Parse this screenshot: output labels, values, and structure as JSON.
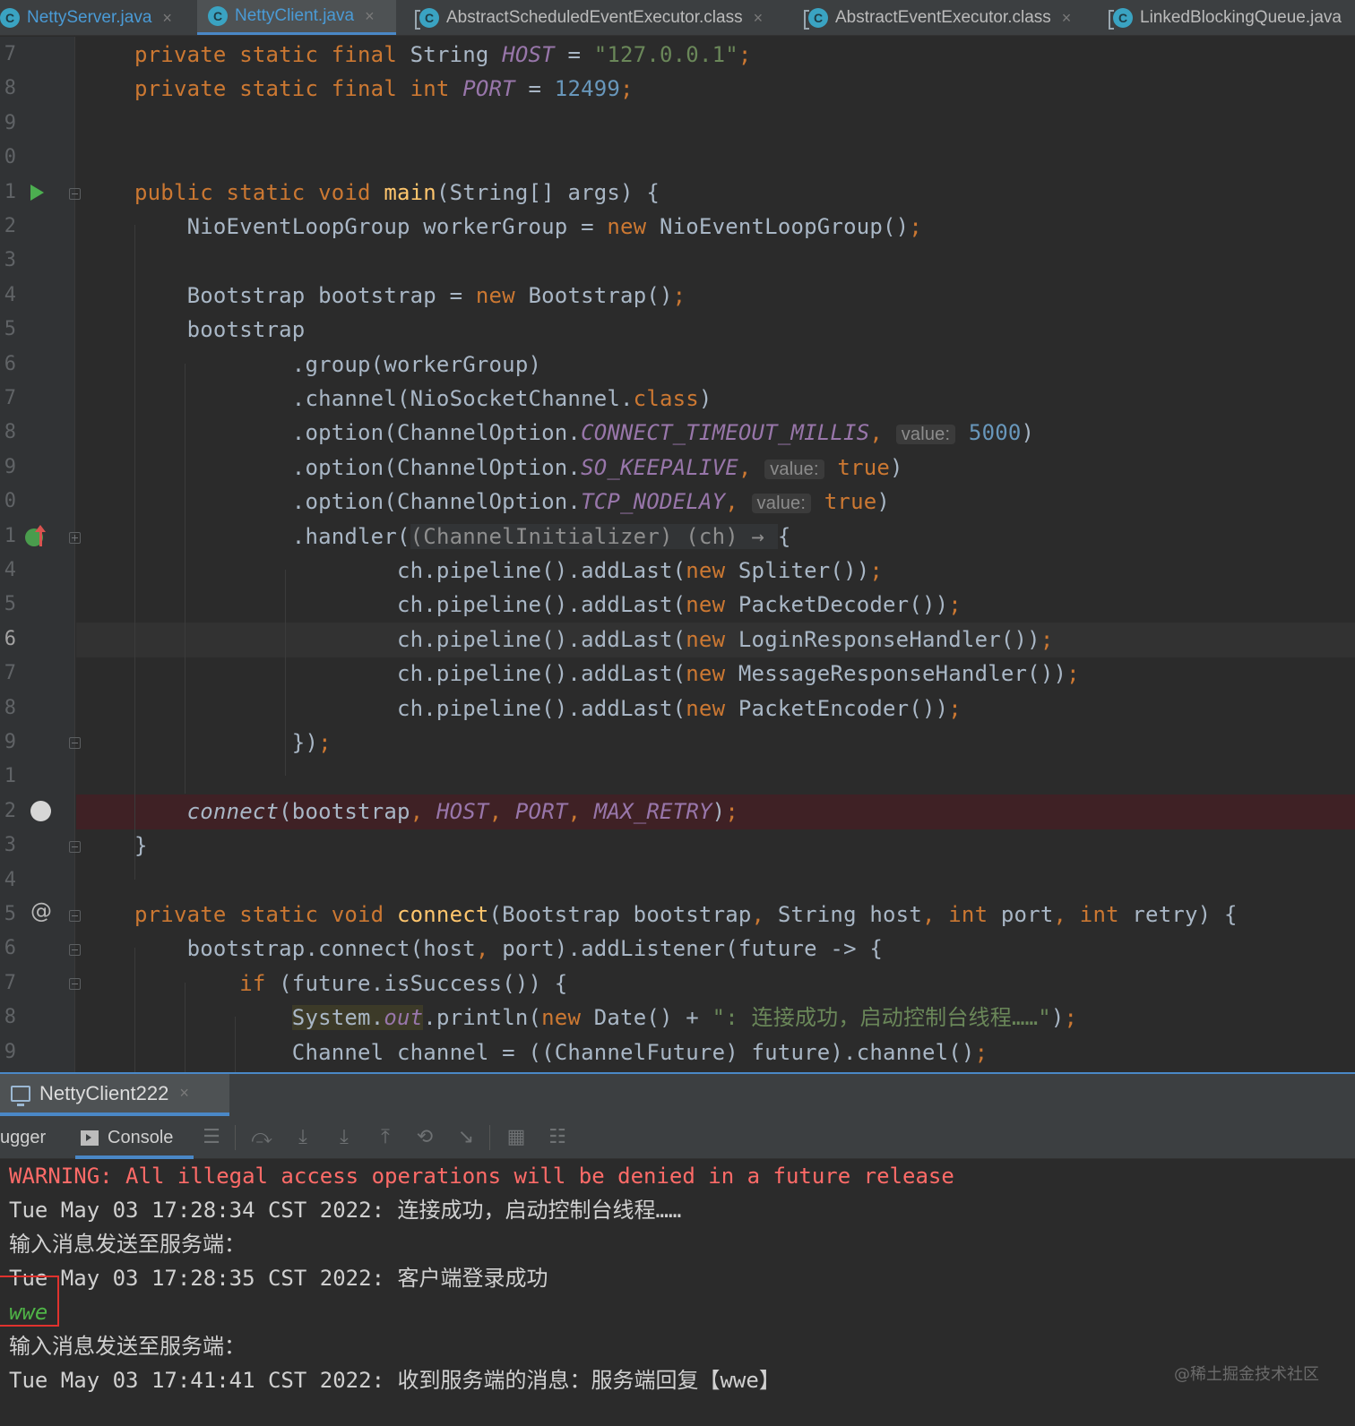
{
  "tabs": [
    {
      "label": "NettyServer.java",
      "icon": "C",
      "active": false
    },
    {
      "label": "NettyClient.java",
      "icon": "C",
      "active": true
    },
    {
      "label": "AbstractScheduledEventExecutor.class",
      "icon": "C",
      "active": false
    },
    {
      "label": "AbstractEventExecutor.class",
      "icon": "C",
      "active": false
    },
    {
      "label": "LinkedBlockingQueue.java",
      "icon": "C",
      "active": false
    }
  ],
  "tab_close_glyph": "×",
  "editor": {
    "line_numbers": [
      "7",
      "8",
      "9",
      "0",
      "1",
      "2",
      "3",
      "4",
      "5",
      "6",
      "7",
      "8",
      "9",
      "0",
      "1",
      "4",
      "5",
      "6",
      "7",
      "8",
      "9",
      "1",
      "2",
      "3",
      "4",
      "5",
      "6",
      "7",
      "8",
      "9"
    ],
    "lines": [
      [
        [
          "kw",
          "private static final "
        ],
        [
          "tx",
          "String "
        ],
        [
          "sf",
          "HOST"
        ],
        [
          "tx",
          " = "
        ],
        [
          "str",
          "\"127.0.0.1\""
        ],
        [
          "kw",
          ";"
        ]
      ],
      [
        [
          "kw",
          "private static final int "
        ],
        [
          "sf",
          "PORT"
        ],
        [
          "tx",
          " = "
        ],
        [
          "num",
          "12499"
        ],
        [
          "kw",
          ";"
        ]
      ],
      [],
      [],
      [
        [
          "kw",
          "public static void "
        ],
        [
          "fn",
          "main"
        ],
        [
          "tx",
          "(String[] args) {"
        ]
      ],
      [
        [
          "tx",
          "    NioEventLoopGroup workerGroup = "
        ],
        [
          "kw",
          "new "
        ],
        [
          "tx",
          "NioEventLoopGroup()"
        ],
        [
          "kw",
          ";"
        ]
      ],
      [],
      [
        [
          "tx",
          "    Bootstrap bootstrap = "
        ],
        [
          "kw",
          "new "
        ],
        [
          "tx",
          "Bootstrap()"
        ],
        [
          "kw",
          ";"
        ]
      ],
      [
        [
          "tx",
          "    bootstrap"
        ]
      ],
      [
        [
          "tx",
          "            .group(workerGroup)"
        ]
      ],
      [
        [
          "tx",
          "            .channel(NioSocketChannel."
        ],
        [
          "kw",
          "class"
        ],
        [
          "tx",
          ")"
        ]
      ],
      [
        [
          "tx",
          "            .option(ChannelOption."
        ],
        [
          "sf",
          "CONNECT_TIMEOUT_MILLIS"
        ],
        [
          "kw",
          ", "
        ],
        [
          "hint",
          "value:"
        ],
        [
          "num",
          " 5000"
        ],
        [
          "tx",
          ")"
        ]
      ],
      [
        [
          "tx",
          "            .option(ChannelOption."
        ],
        [
          "sf",
          "SO_KEEPALIVE"
        ],
        [
          "kw",
          ", "
        ],
        [
          "hint",
          "value:"
        ],
        [
          "kw",
          " true"
        ],
        [
          "tx",
          ")"
        ]
      ],
      [
        [
          "tx",
          "            .option(ChannelOption."
        ],
        [
          "sf",
          "TCP_NODELAY"
        ],
        [
          "kw",
          ", "
        ],
        [
          "hint",
          "value:"
        ],
        [
          "kw",
          " true"
        ],
        [
          "tx",
          ")"
        ]
      ],
      [
        [
          "tx",
          "            .handler("
        ],
        [
          "lamb",
          "(ChannelInitializer) (ch) → "
        ],
        [
          "tx",
          "{"
        ]
      ],
      [
        [
          "tx",
          "                    ch.pipeline().addLast("
        ],
        [
          "kw",
          "new "
        ],
        [
          "tx",
          "Spliter())"
        ],
        [
          "kw",
          ";"
        ]
      ],
      [
        [
          "tx",
          "                    ch.pipeline().addLast("
        ],
        [
          "kw",
          "new "
        ],
        [
          "tx",
          "PacketDecoder())"
        ],
        [
          "kw",
          ";"
        ]
      ],
      [
        [
          "tx",
          "                    ch.pipeline().addLast("
        ],
        [
          "kw",
          "new "
        ],
        [
          "tx",
          "LoginResponseHandler())"
        ],
        [
          "kw",
          ";"
        ]
      ],
      [
        [
          "tx",
          "                    ch.pipeline().addLast("
        ],
        [
          "kw",
          "new "
        ],
        [
          "tx",
          "MessageResponseHandler())"
        ],
        [
          "kw",
          ";"
        ]
      ],
      [
        [
          "tx",
          "                    ch.pipeline().addLast("
        ],
        [
          "kw",
          "new "
        ],
        [
          "tx",
          "PacketEncoder())"
        ],
        [
          "kw",
          ";"
        ]
      ],
      [
        [
          "tx",
          "            })"
        ],
        [
          "kw",
          ";"
        ]
      ],
      [],
      [
        [
          "it",
          "    connect"
        ],
        [
          "tx",
          "(bootstrap"
        ],
        [
          "kw",
          ", "
        ],
        [
          "sf",
          "HOST"
        ],
        [
          "kw",
          ", "
        ],
        [
          "sf",
          "PORT"
        ],
        [
          "kw",
          ", "
        ],
        [
          "sf",
          "MAX_RETRY"
        ],
        [
          "tx",
          ")"
        ],
        [
          "kw",
          ";"
        ]
      ],
      [
        [
          "tx",
          "}"
        ]
      ],
      [],
      [
        [
          "kw",
          "private static void "
        ],
        [
          "fn",
          "connect"
        ],
        [
          "tx",
          "(Bootstrap bootstrap"
        ],
        [
          "kw",
          ", "
        ],
        [
          "tx",
          "String host"
        ],
        [
          "kw",
          ", int "
        ],
        [
          "tx",
          "port"
        ],
        [
          "kw",
          ", int "
        ],
        [
          "tx",
          "retry) {"
        ]
      ],
      [
        [
          "tx",
          "    bootstrap.connect(host"
        ],
        [
          "kw",
          ", "
        ],
        [
          "tx",
          "port).addListener(future -> {"
        ]
      ],
      [
        [
          "tx",
          "        "
        ],
        [
          "kw",
          "if "
        ],
        [
          "tx",
          "(future.isSuccess()) {"
        ]
      ],
      [
        [
          "tx",
          "            "
        ],
        [
          "sys",
          "System."
        ],
        [
          "sysf",
          "out"
        ],
        [
          "tx",
          ".println("
        ],
        [
          "kw",
          "new "
        ],
        [
          "tx",
          "Date() + "
        ],
        [
          "str",
          "\": 连接成功，启动控制台线程……\""
        ],
        [
          "tx",
          ")"
        ],
        [
          "kw",
          ";"
        ]
      ],
      [
        [
          "tx",
          "            Channel channel = ((ChannelFuture) future).channel()"
        ],
        [
          "kw",
          ";"
        ]
      ]
    ]
  },
  "run_panel": {
    "tab_label": "NettyClient222",
    "debugger_label": "ugger",
    "console_label": "Console"
  },
  "console": {
    "lines": [
      "WARNING: All illegal access operations will be denied in a future release",
      "Tue May 03 17:28:34 CST 2022: 连接成功，启动控制台线程……",
      "输入消息发送至服务端：",
      "Tue May 03 17:28:35 CST 2022: 客户端登录成功",
      "wwe",
      "输入消息发送至服务端：",
      "Tue May 03 17:41:41 CST 2022: 收到服务端的消息：服务端回复【wwe】"
    ]
  },
  "watermark": "@稀土掘金技术社区",
  "colors": {
    "keyword": "#cc7832",
    "static_field": "#9876aa",
    "string": "#6a8759",
    "number": "#6897bb",
    "method_decl": "#ffc66d",
    "warning": "#ff6b68",
    "user_input": "#4fb447",
    "accent": "#4a88c7",
    "breakpoint_line": "#3f2125"
  }
}
